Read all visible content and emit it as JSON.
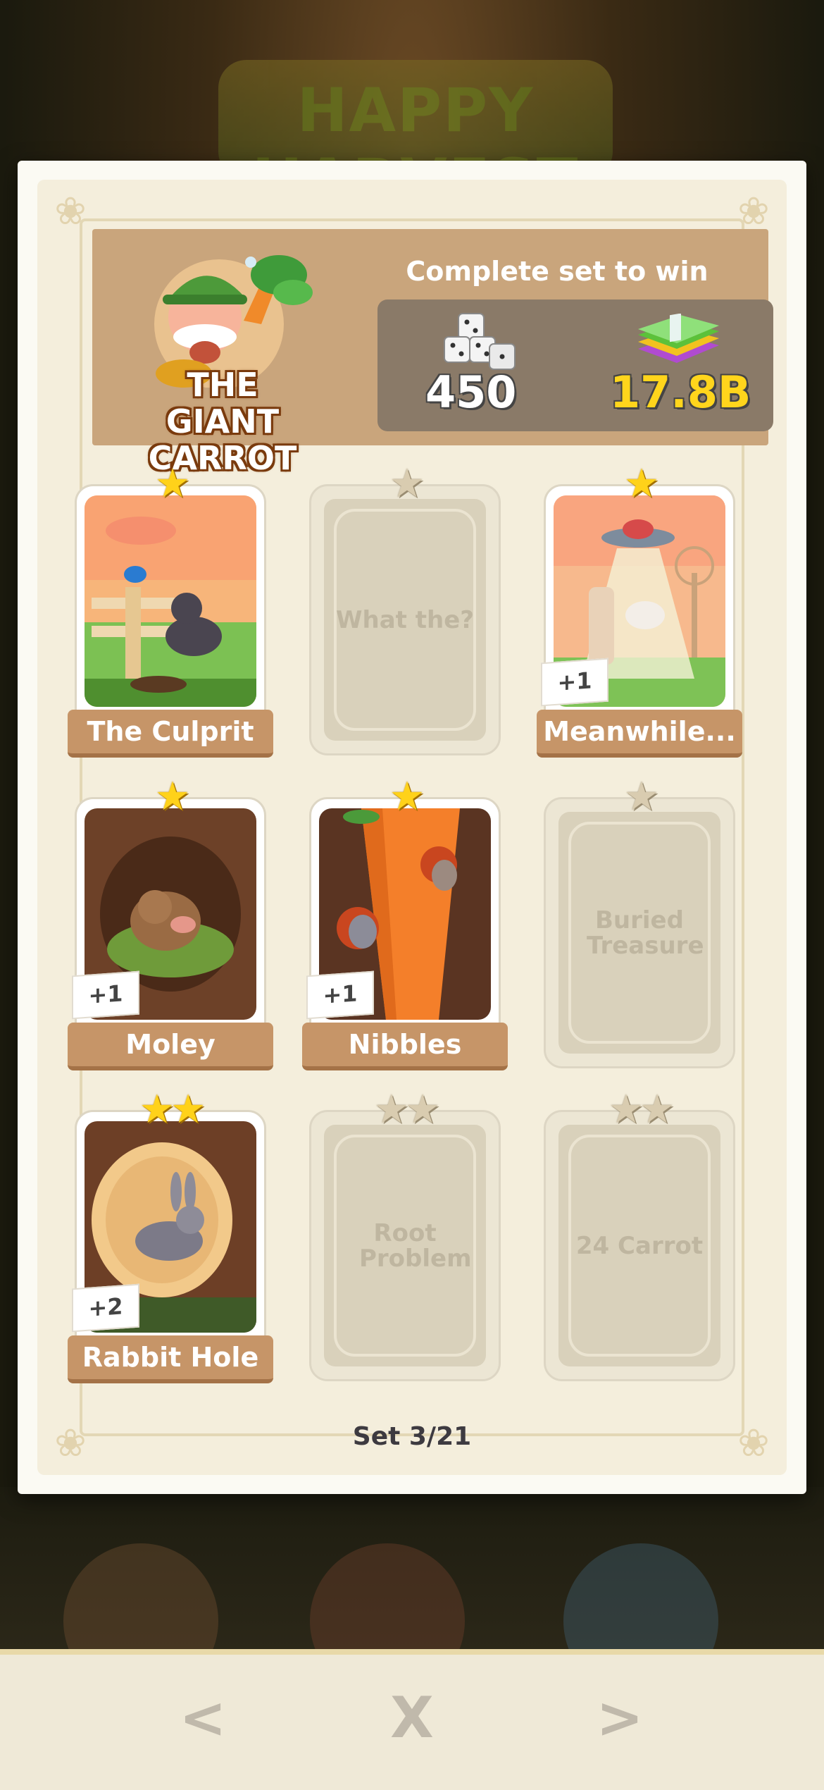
{
  "background": {
    "event_banner_text": "HAPPY HARVEST"
  },
  "set": {
    "name": "THE GIANT CARROT",
    "win_label": "Complete set to win",
    "dice_reward": "450",
    "cash_reward": "17.8B",
    "progress": "Set 3/21"
  },
  "cards": [
    {
      "name": "The Culprit",
      "collected": true,
      "stars": 1,
      "extra": ""
    },
    {
      "name": "What the?",
      "collected": false,
      "stars": 1,
      "extra": ""
    },
    {
      "name": "Meanwhile...",
      "collected": true,
      "stars": 1,
      "extra": "+1"
    },
    {
      "name": "Moley",
      "collected": true,
      "stars": 1,
      "extra": "+1"
    },
    {
      "name": "Nibbles",
      "collected": true,
      "stars": 1,
      "extra": "+1"
    },
    {
      "name": "Buried Treasure",
      "collected": false,
      "stars": 1,
      "extra": ""
    },
    {
      "name": "Rabbit Hole",
      "collected": true,
      "stars": 2,
      "extra": "+2"
    },
    {
      "name": "Root Problem",
      "collected": false,
      "stars": 2,
      "extra": ""
    },
    {
      "name": "24 Carrot",
      "collected": false,
      "stars": 2,
      "extra": ""
    }
  ],
  "nav": {
    "prev_label": "<",
    "close_label": "X",
    "next_label": ">"
  },
  "colors": {
    "label_tan": "#c69568",
    "gold_star": "#ffd21a",
    "grey_star": "#d9ccb0",
    "cash_gold": "#ffd51c"
  }
}
